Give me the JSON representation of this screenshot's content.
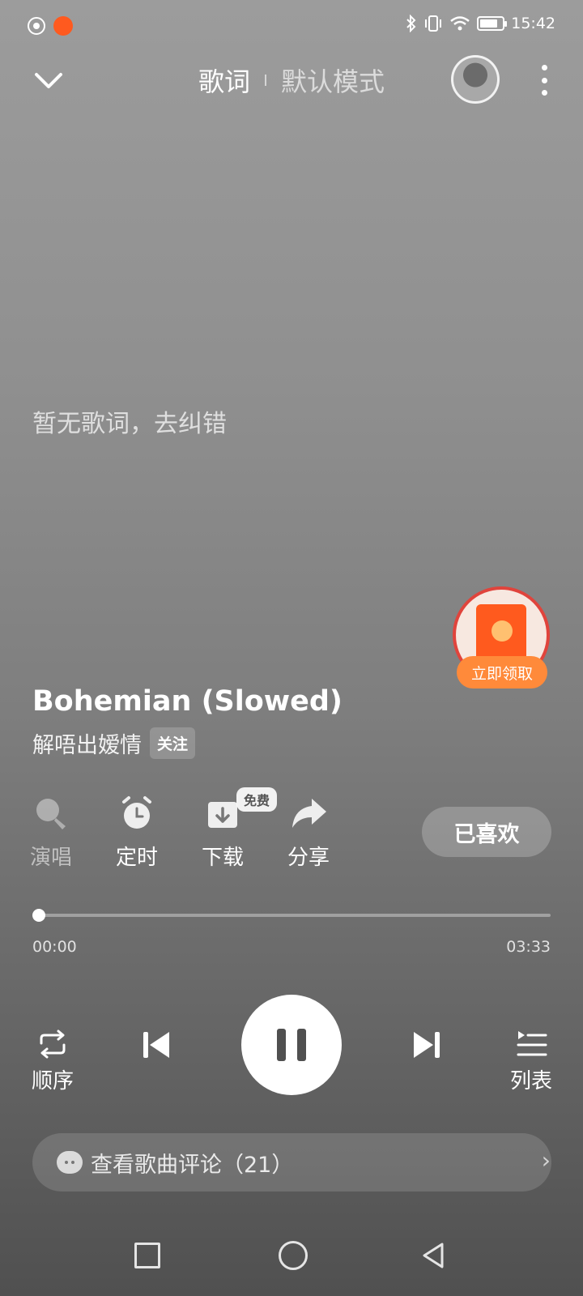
{
  "status_bar": {
    "time": "15:42",
    "battery_level": 0.8
  },
  "header": {
    "tab_lyrics": "歌词",
    "tab_mode": "默认模式"
  },
  "lyrics": {
    "empty_text": "暂无歌词，去纠错"
  },
  "promo": {
    "claim_label": "立即领取"
  },
  "song": {
    "title": "Bohemian (Slowed)",
    "artist": "解唔出嫒情",
    "follow_label": "关注"
  },
  "actions": {
    "sing": "演唱",
    "timer": "定时",
    "download": "下载",
    "download_badge": "免费",
    "share": "分享",
    "liked": "已喜欢"
  },
  "progress": {
    "current": "00:00",
    "total": "03:33",
    "fraction": 0.0
  },
  "controls": {
    "repeat_label": "顺序",
    "playlist_label": "列表"
  },
  "comments": {
    "label": "查看歌曲评论（21）"
  },
  "colors": {
    "promo_orange": "#ff5a1e",
    "promo_ring": "#e0443c"
  }
}
